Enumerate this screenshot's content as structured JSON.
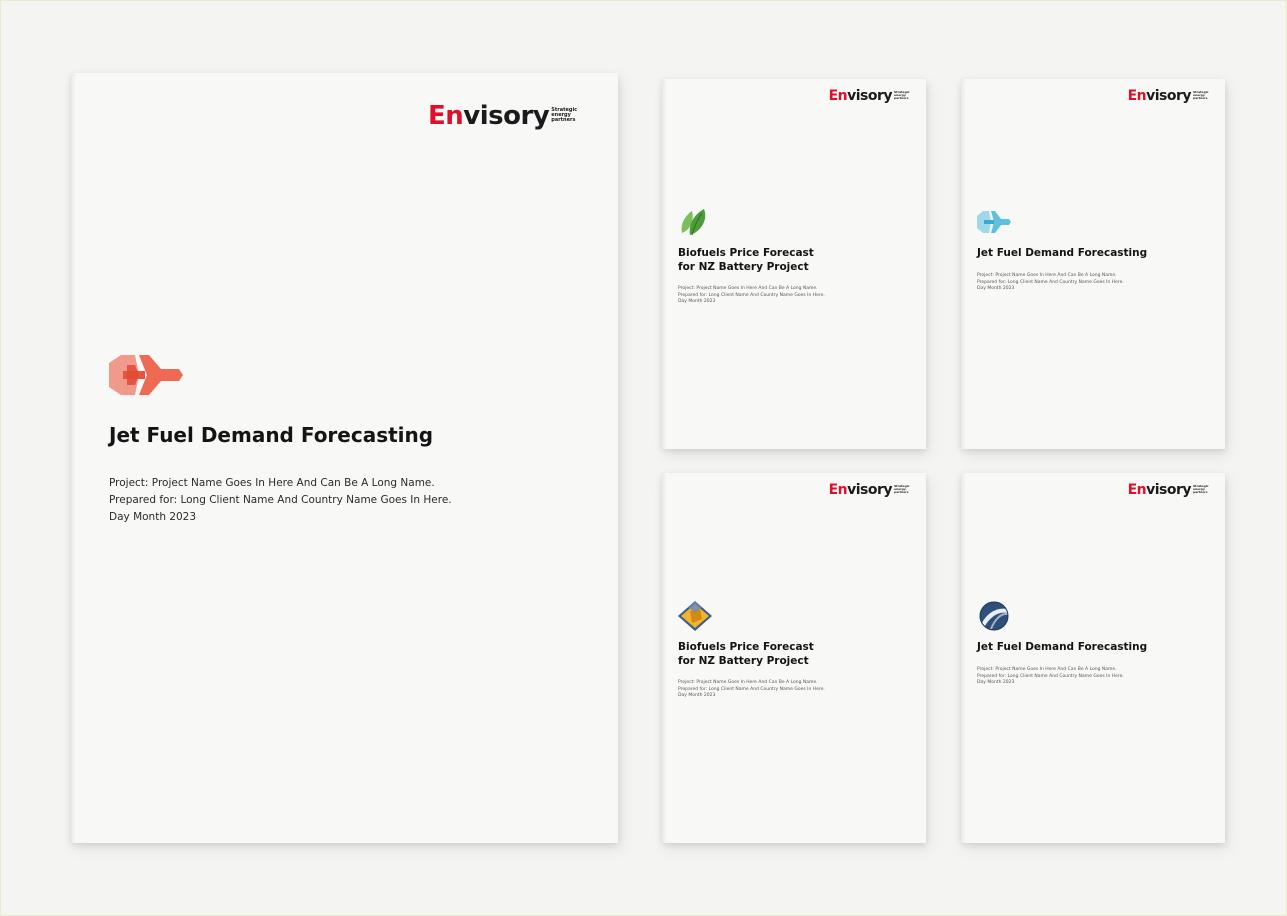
{
  "brand": {
    "logo_en": "En",
    "logo_visory": "visory",
    "tagline": "Strategic energy partners",
    "colors": {
      "red": "#e0102b",
      "dark": "#1b1b1b"
    }
  },
  "main_page": {
    "icon": "jet-plane-icon",
    "title": "Jet Fuel Demand Forecasting",
    "project": "Project: Project Name Goes In Here And Can Be A Long Name.",
    "prepared": "Prepared for: Long Client Name And Country Name Goes In Here.",
    "date": "Day Month 2023"
  },
  "small_pages": [
    {
      "icon": "leaf-icon",
      "title_line1": "Biofuels Price Forecast",
      "title_line2": "for NZ Battery Project",
      "project": "Project: Project Name Goes In Here And Can Be A Long Name.",
      "prepared": "Prepared for: Long Client Name And Country Name Goes In Here.",
      "date": "Day Month 2023"
    },
    {
      "icon": "jet-plane-icon",
      "title_line1": "Jet Fuel Demand Forecasting",
      "project": "Project: Project Name Goes In Here And Can Be A Long Name.",
      "prepared": "Prepared for: Long Client Name And Country Name Goes In Here.",
      "date": "Day Month 2023"
    },
    {
      "icon": "battery-diamond-icon",
      "title_line1": "Biofuels Price Forecast",
      "title_line2": "for NZ Battery Project",
      "project": "Project: Project Name Goes In Here And Can Be A Long Name.",
      "prepared": "Prepared for: Long Client Name And Country Name Goes In Here.",
      "date": "Day Month 2023"
    },
    {
      "icon": "road-circle-icon",
      "title_line1": "Jet Fuel Demand Forecasting",
      "project": "Project: Project Name Goes In Here And Can Be A Long Name.",
      "prepared": "Prepared for: Long Client Name And Country Name Goes In Here.",
      "date": "Day Month 2023"
    }
  ]
}
